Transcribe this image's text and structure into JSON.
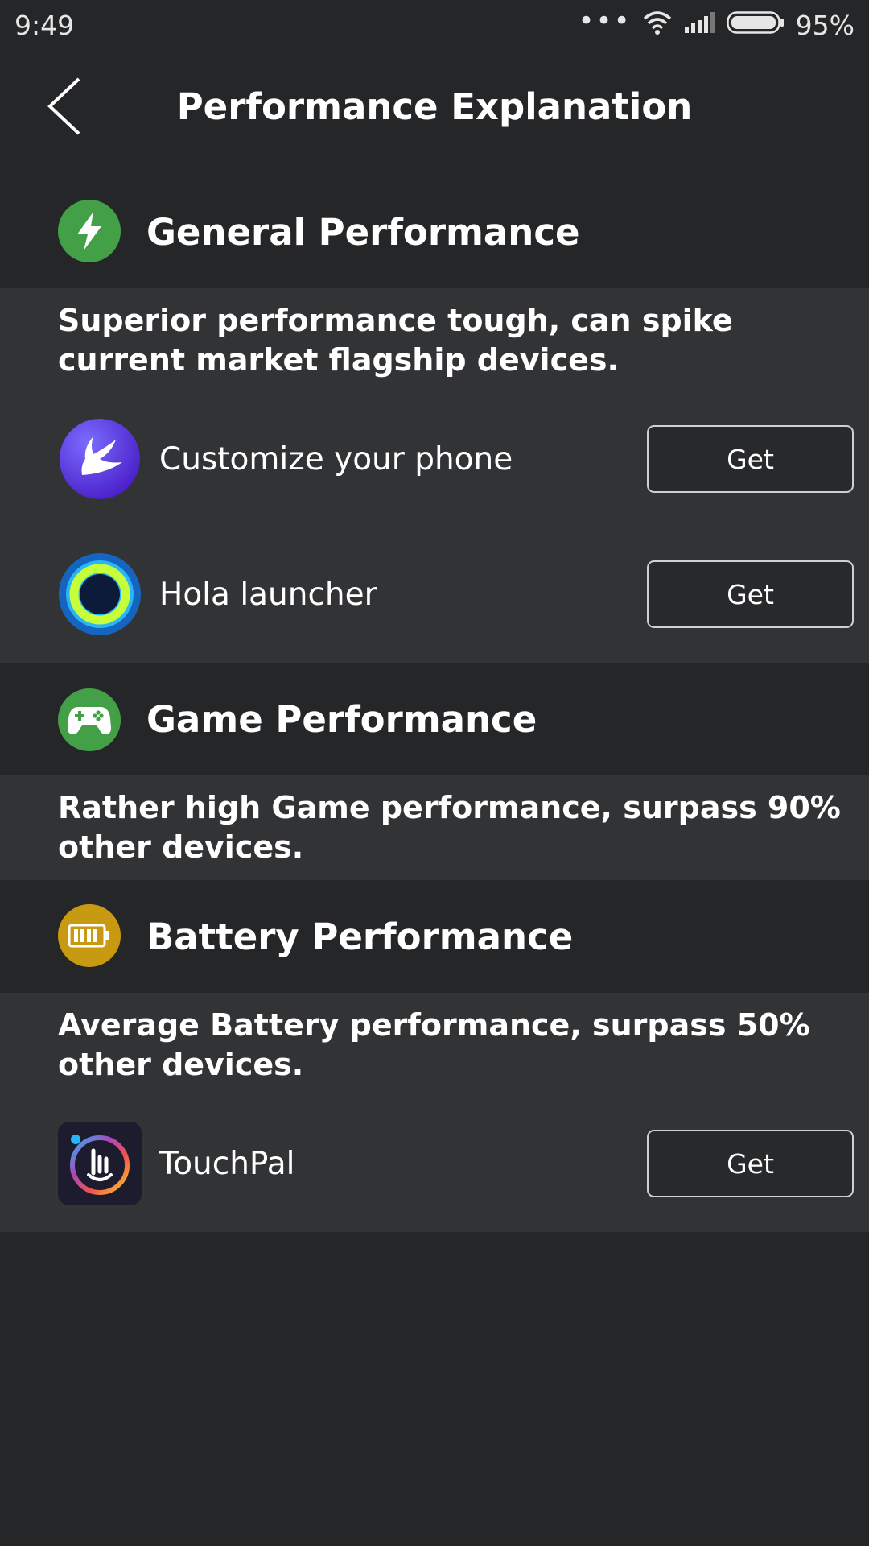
{
  "status_bar": {
    "time": "9:49",
    "battery_percent": "95%",
    "signal_dots": "•••",
    "icons": [
      "wifi-icon",
      "signal-icon",
      "battery-icon"
    ]
  },
  "header": {
    "title": "Performance Explanation",
    "back_icon": "chevron-left-icon"
  },
  "sections": [
    {
      "title": "General Performance",
      "icon": "lightning-icon",
      "icon_color": "#43a047",
      "description": "Superior performance tough, can spike current market flagship devices.",
      "apps": [
        {
          "name": "Customize your phone",
          "button": "Get",
          "icon": "apus-launcher-icon"
        },
        {
          "name": "Hola launcher",
          "button": "Get",
          "icon": "hola-launcher-icon"
        }
      ]
    },
    {
      "title": "Game Performance",
      "icon": "gamepad-icon",
      "icon_color": "#43a047",
      "description": "Rather high Game performance, surpass 90% other devices."
    },
    {
      "title": "Battery Performance",
      "icon": "battery-icon",
      "icon_color": "#c89a12",
      "description": "Average Battery performance, surpass 50% other devices.",
      "apps": [
        {
          "name": "TouchPal",
          "button": "Get",
          "icon": "touchpal-icon"
        }
      ]
    }
  ],
  "colors": {
    "background": "#252628",
    "card": "#323335",
    "green": "#43a047",
    "gold": "#c89a12"
  }
}
